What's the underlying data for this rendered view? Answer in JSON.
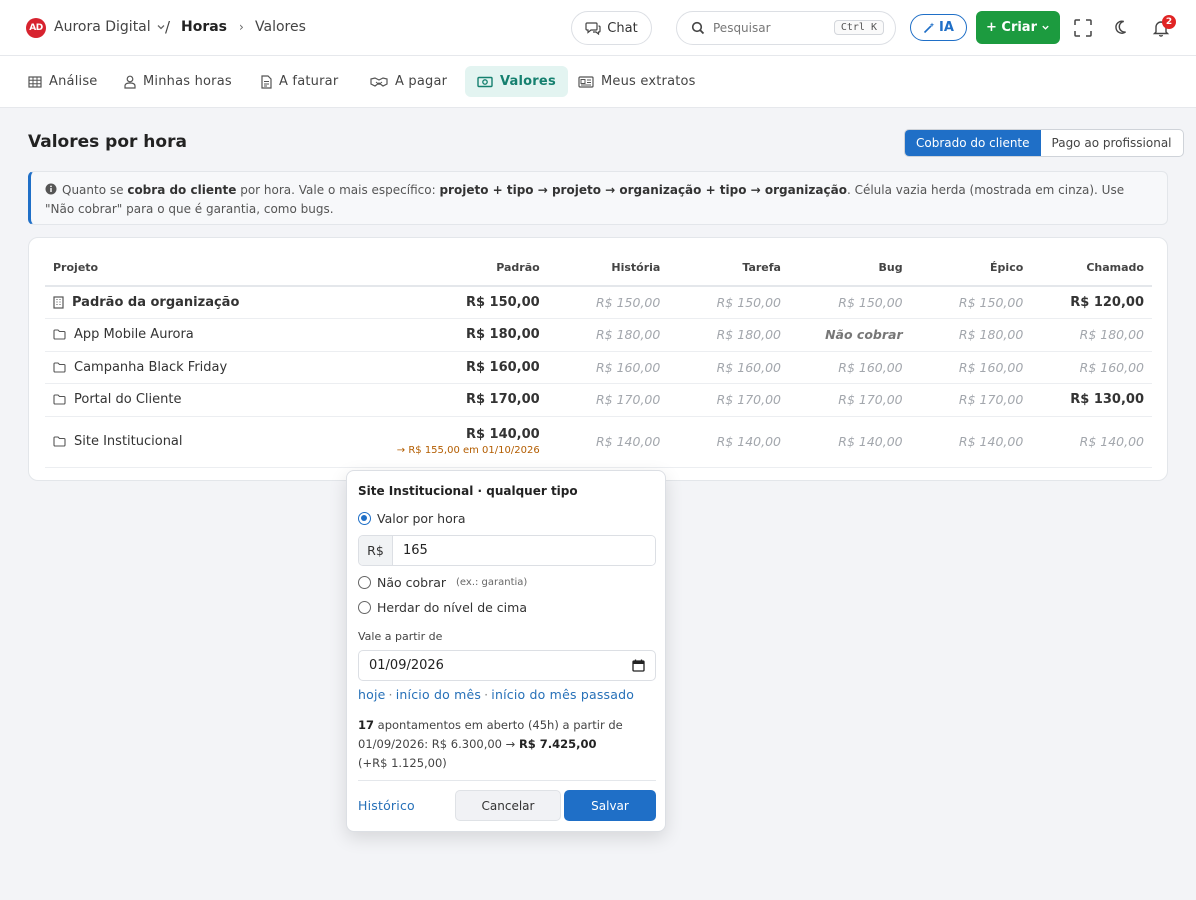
{
  "app": {
    "logo_text": "AD",
    "org_name": "Aurora Digital",
    "crumb_sep": "/",
    "crumb_section": "Horas",
    "crumb_arrow": "›",
    "crumb_page": "Valores"
  },
  "topbar": {
    "chat_label": "Chat",
    "search_placeholder": "Pesquisar",
    "search_shortcut": "Ctrl K",
    "ia_label": "IA",
    "criar_label": "+ Criar",
    "notifications_count": "2"
  },
  "tabs": [
    {
      "label": "Análise",
      "icon": "grid-icon"
    },
    {
      "label": "Minhas horas",
      "icon": "user-icon"
    },
    {
      "label": "A faturar",
      "icon": "document-icon"
    },
    {
      "label": "A pagar",
      "icon": "handshake-icon"
    },
    {
      "label": "Valores",
      "icon": "money-icon",
      "active": true
    },
    {
      "label": "Meus extratos",
      "icon": "statement-icon"
    }
  ],
  "page": {
    "title": "Valores por hora",
    "toggle": {
      "charged": "Cobrado do cliente",
      "paid": "Pago ao profissional",
      "active": "charged"
    }
  },
  "info": {
    "t1": "Quanto se ",
    "b1": "cobra do cliente",
    "t2": " por hora. Vale o mais específico: ",
    "b2": "projeto + tipo → projeto → organização + tipo → organização",
    "t3": ". Célula vazia herda (mostrada em cinza). Use \"Não cobrar\" para o que é garantia, como bugs."
  },
  "table": {
    "headers": [
      "Projeto",
      "Padrão",
      "História",
      "Tarefa",
      "Bug",
      "Épico",
      "Chamado"
    ],
    "rows": [
      {
        "name": "Padrão da organização",
        "org": true,
        "default": "R$ 150,00",
        "historia": "R$ 150,00",
        "tarefa": "R$ 150,00",
        "bug": "R$ 150,00",
        "epico": "R$ 150,00",
        "chamado": "R$ 120,00"
      },
      {
        "name": "App Mobile Aurora",
        "default": "R$ 180,00",
        "historia": "R$ 180,00",
        "tarefa": "R$ 180,00",
        "bug": "Não cobrar",
        "epico": "R$ 180,00",
        "chamado": "R$ 180,00"
      },
      {
        "name": "Campanha Black Friday",
        "default": "R$ 160,00",
        "historia": "R$ 160,00",
        "tarefa": "R$ 160,00",
        "bug": "R$ 160,00",
        "epico": "R$ 160,00",
        "chamado": "R$ 160,00"
      },
      {
        "name": "Portal do Cliente",
        "default": "R$ 170,00",
        "historia": "R$ 170,00",
        "tarefa": "R$ 170,00",
        "bug": "R$ 170,00",
        "epico": "R$ 170,00",
        "chamado": "R$ 130,00"
      },
      {
        "name": "Site Institucional",
        "default": "R$ 140,00",
        "scheduled": "→ R$ 155,00 em 01/10/2026",
        "historia": "R$ 140,00",
        "tarefa": "R$ 140,00",
        "bug": "R$ 140,00",
        "epico": "R$ 140,00",
        "chamado": "R$ 140,00"
      }
    ]
  },
  "popover": {
    "title": "Site Institucional · qualquer tipo",
    "opt_rate": "Valor por hora",
    "currency": "R$",
    "rate_value": "165",
    "opt_nocharge": "Não cobrar",
    "opt_nocharge_hint": "(ex.: garantia)",
    "opt_inherit": "Herdar do nível de cima",
    "from_label": "Vale a partir de",
    "date_value": "01/09/2026",
    "quick_today": "hoje",
    "quick_month": "início do mês",
    "quick_prev": "início do mês passado",
    "quick_sep": "·",
    "impact_count": "17",
    "impact_text": " apontamentos em aberto (45h) a partir de 01/09/2026: R$ 6.300,00 → ",
    "impact_new": "R$ 7.425,00",
    "impact_delta": "(+R$ 1.125,00)",
    "history_label": "Histórico",
    "cancel_label": "Cancelar",
    "save_label": "Salvar"
  },
  "colors": {
    "primary": "#1f6fc7",
    "success": "#1c9b3f",
    "tab_active_bg": "#e3f4f1",
    "tab_active_text": "#15806f",
    "logo_red": "#d7232f",
    "scheduled": "#b35d00"
  }
}
